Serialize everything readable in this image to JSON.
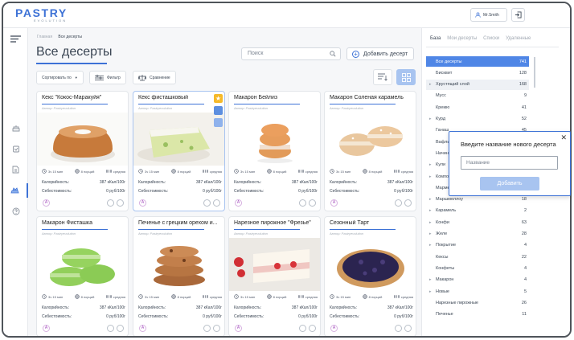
{
  "header": {
    "logo": "PASTRY",
    "logo_sub": "EVOLUTION",
    "user": "Mr.Smith"
  },
  "breadcrumb": {
    "home": "Главная",
    "current": "Все десерты"
  },
  "page_title": "Все десерты",
  "search": {
    "placeholder": "Поиск"
  },
  "add_dessert_label": "Добавить десерт",
  "toolbar": {
    "sort_label": "Сортировать по",
    "filter_label": "Фильтр",
    "compare_label": "Сравнение"
  },
  "cards": [
    {
      "name": "Кекс \"Кокос-Маракуйя\"",
      "author": "Автор: Pastryevolution",
      "time": "3ч 15 мин",
      "portions": "8 порций",
      "difficulty": "средняя",
      "cal_label": "Калорийность:",
      "cal": "387 кКал/100г",
      "cost_label": "Себестоимость:",
      "cost": "0 руб/100г",
      "badge": "A"
    },
    {
      "name": "Кекс фисташковый",
      "author": "Автор: Pastryevolution",
      "time": "3ч 15 мин",
      "portions": "8 порций",
      "difficulty": "средняя",
      "cal_label": "Калорийность:",
      "cal": "387 кКал/100г",
      "cost_label": "Себестоимость:",
      "cost": "0 руб/100г",
      "badge": "A"
    },
    {
      "name": "Макарон Бейлиз",
      "author": "Автор: Pastryevolution",
      "time": "3ч 15 мин",
      "portions": "8 порций",
      "difficulty": "средняя",
      "cal_label": "Калорийность:",
      "cal": "387 кКал/100г",
      "cost_label": "Себестоимость:",
      "cost": "0 руб/100г",
      "badge": "A"
    },
    {
      "name": "Макарон Соленая карамель",
      "author": "Автор: Pastryevolution",
      "time": "3ч 15 мин",
      "portions": "8 порций",
      "difficulty": "средняя",
      "cal_label": "Калорийность:",
      "cal": "387 кКал/100г",
      "cost_label": "Себестоимость:",
      "cost": "0 руб/100г",
      "badge": "A"
    },
    {
      "name": "Макарон Фисташка",
      "author": "Автор: Pastryevolution",
      "time": "3ч 15 мин",
      "portions": "8 порций",
      "difficulty": "средняя",
      "cal_label": "Калорийность:",
      "cal": "387 кКал/100г",
      "cost_label": "Себестоимость:",
      "cost": "0 руб/100г",
      "badge": "A"
    },
    {
      "name": "Печенье с грецким орехом и...",
      "author": "Автор: Pastryevolution",
      "time": "3ч 15 мин",
      "portions": "8 порций",
      "difficulty": "средняя",
      "cal_label": "Калорийность:",
      "cal": "387 кКал/100г",
      "cost_label": "Себестоимость:",
      "cost": "0 руб/100г",
      "badge": "A"
    },
    {
      "name": "Нарезное пирожное \"Фрезье\"",
      "author": "Автор: Pastryevolution",
      "time": "3ч 15 мин",
      "portions": "8 порций",
      "difficulty": "средняя",
      "cal_label": "Калорийность:",
      "cal": "387 кКал/100г",
      "cost_label": "Себестоимость:",
      "cost": "0 руб/100г",
      "badge": "A"
    },
    {
      "name": "Сезонный Тарт",
      "author": "Автор: Pastryevolution",
      "time": "3ч 15 мин",
      "portions": "8 порций",
      "difficulty": "средняя",
      "cal_label": "Калорийность:",
      "cal": "387 кКал/100г",
      "cost_label": "Себестоимость:",
      "cost": "0 руб/100г",
      "badge": "A"
    }
  ],
  "sidebar": {
    "tabs": [
      "База",
      "Мои десерты",
      "Списки",
      "Удаленные"
    ],
    "items": [
      {
        "label": "Все десерты",
        "count": "741"
      },
      {
        "label": "Бисквит",
        "count": "128"
      },
      {
        "label": "Хрустящий слой",
        "count": "168"
      },
      {
        "label": "Мусс",
        "count": "9"
      },
      {
        "label": "Кремю",
        "count": "41"
      },
      {
        "label": "Курд",
        "count": "52"
      },
      {
        "label": "Ганаш",
        "count": "45"
      },
      {
        "label": "Вафли",
        "count": ""
      },
      {
        "label": "Начинка",
        "count": ""
      },
      {
        "label": "Кули",
        "count": ""
      },
      {
        "label": "Компоте",
        "count": ""
      },
      {
        "label": "Мармелад",
        "count": ""
      },
      {
        "label": "Маршмеллоу",
        "count": "18"
      },
      {
        "label": "Карамель",
        "count": "2"
      },
      {
        "label": "Конфи",
        "count": "63"
      },
      {
        "label": "Желе",
        "count": "28"
      },
      {
        "label": "Покрытие",
        "count": "4"
      },
      {
        "label": "Кексы",
        "count": "22"
      },
      {
        "label": "Конфеты",
        "count": "4"
      },
      {
        "label": "Макарон",
        "count": "4"
      },
      {
        "label": "Новые",
        "count": "5"
      },
      {
        "label": "Нарезные пирожные",
        "count": "26"
      },
      {
        "label": "Печенье",
        "count": "11"
      }
    ]
  },
  "popup": {
    "title": "Введите название нового десерта",
    "placeholder": "Название",
    "button": "Добавить"
  }
}
